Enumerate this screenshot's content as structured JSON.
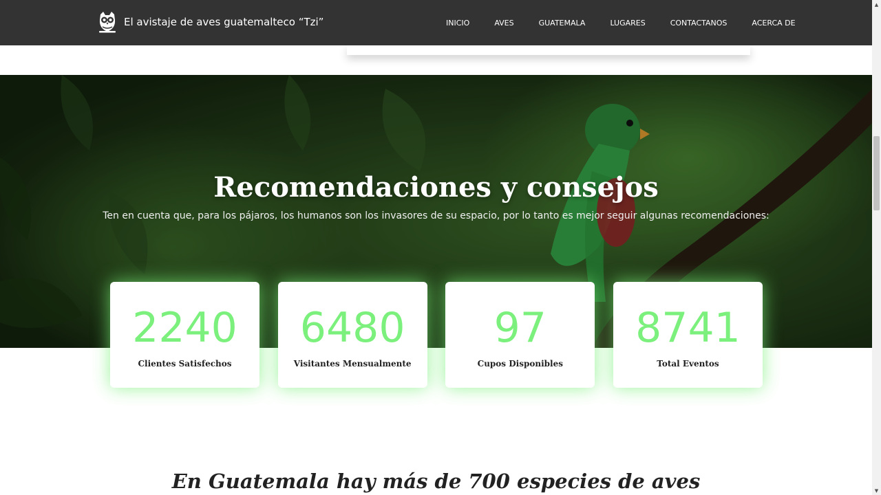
{
  "brand": {
    "title": "El avistaje de aves guatemalteco “Tzi”",
    "logo_icon": "owl-icon"
  },
  "nav": {
    "items": [
      "INICIO",
      "AVES",
      "GUATEMALA",
      "LUGARES",
      "CONTACTANOS",
      "ACERCA DE"
    ]
  },
  "hero": {
    "title": "Recomendaciones y consejos",
    "subtitle": "Ten en cuenta que, para los pájaros, los humanos son los invasores de su espacio, por lo tanto es mejor seguir algunas recomendaciones:",
    "background": "quetzal-bird-photo"
  },
  "counters": [
    {
      "value": "2240",
      "label": "Clientes Satisfechos"
    },
    {
      "value": "6480",
      "label": "Visitantes Mensualmente"
    },
    {
      "value": "97",
      "label": "Cupos Disponibles"
    },
    {
      "value": "8741",
      "label": "Total Eventos"
    }
  ],
  "section": {
    "heading": "En Guatemala hay más de 700 especies de aves"
  },
  "colors": {
    "navbar": "#333333",
    "counter_accent": "#7cf07c",
    "glow": "#78f078"
  }
}
